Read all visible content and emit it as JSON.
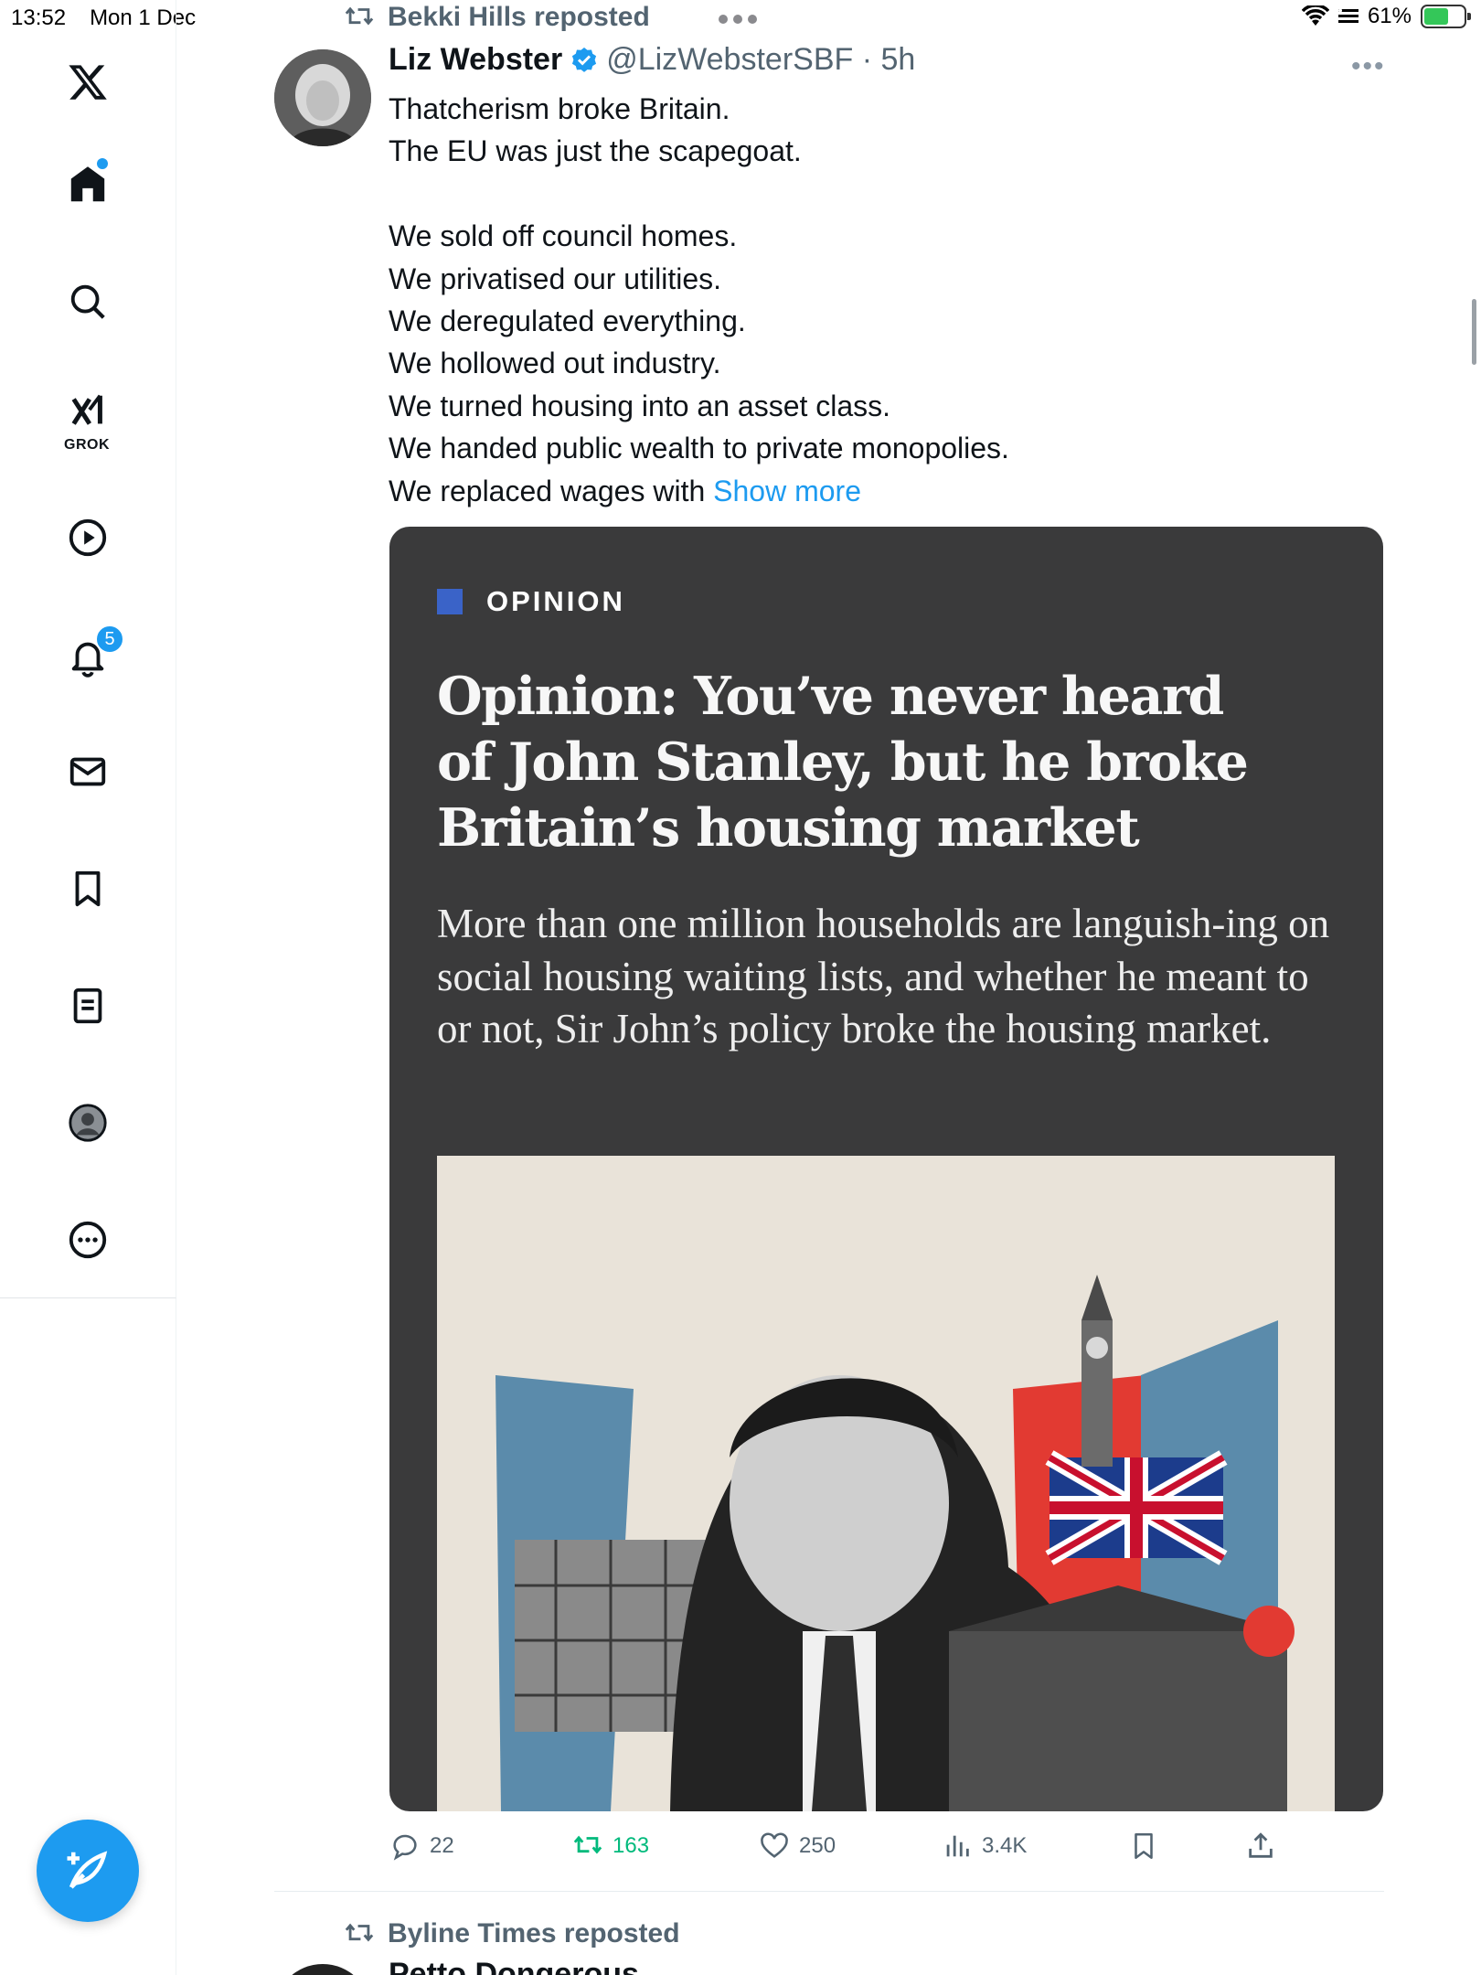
{
  "status_bar": {
    "time": "13:52",
    "date": "Mon 1 Dec",
    "battery_percent": "61%",
    "battery_level": 0.61,
    "icons": [
      "wifi-icon",
      "signal-icon",
      "battery-charging-icon"
    ]
  },
  "sidebar": {
    "items": [
      {
        "name": "x-logo",
        "icon": "x-logo-icon"
      },
      {
        "name": "home",
        "icon": "home-icon"
      },
      {
        "name": "search",
        "icon": "search-icon"
      },
      {
        "name": "grok",
        "icon": "grok-icon",
        "label": "GROK"
      },
      {
        "name": "video",
        "icon": "play-icon"
      },
      {
        "name": "notifications",
        "icon": "bell-icon",
        "badge": "5"
      },
      {
        "name": "messages",
        "icon": "mail-icon"
      },
      {
        "name": "bookmarks",
        "icon": "bookmark-icon"
      },
      {
        "name": "lists",
        "icon": "list-icon"
      },
      {
        "name": "profile",
        "icon": "profile-icon"
      },
      {
        "name": "more",
        "icon": "more-circle-icon"
      }
    ],
    "compose_icon": "compose-icon"
  },
  "post": {
    "repost_label": "Bekki Hills reposted",
    "author_name": "Liz Webster",
    "handle_time": "@LizWebsterSBF · 5h",
    "text": "Thatcherism broke Britain.\nThe EU was just the scapegoat.\n\nWe sold off council homes.\nWe privatised our utilities.\nWe deregulated everything.\nWe hollowed out industry.\nWe turned housing into an asset class.\nWe handed public wealth to private monopolies.\nWe replaced wages with ",
    "show_more": "Show more",
    "card": {
      "kicker": "OPINION",
      "headline": "Opinion: You’ve never heard of John Stanley, but he broke Britain’s housing market",
      "standfirst": "More than one million households are languish-ing on social housing waiting lists, and whether he meant to or not, Sir John’s policy broke the housing market."
    },
    "actions": {
      "replies": "22",
      "reposts": "163",
      "likes": "250",
      "views": "3.4K"
    }
  },
  "next_post": {
    "repost_label": "Byline Times reposted",
    "author_name": "Petto Dongerous"
  }
}
